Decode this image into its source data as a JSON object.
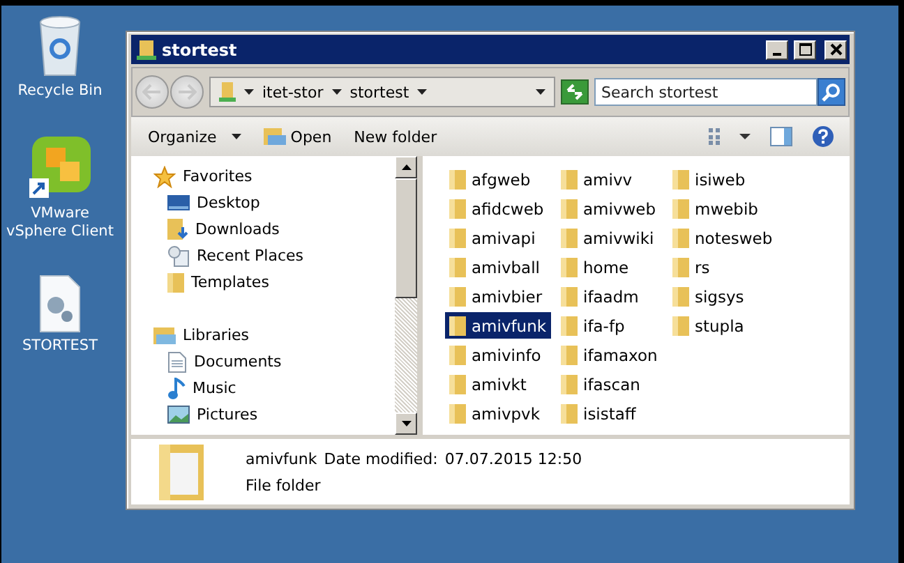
{
  "desktop_icons": [
    {
      "label": "Recycle Bin",
      "kind": "bin"
    },
    {
      "label": "VMware vSphere Client",
      "kind": "vmware"
    },
    {
      "label": "STORTEST",
      "kind": "config"
    }
  ],
  "window": {
    "title": "stortest"
  },
  "address_bar": {
    "breadcrumbs": [
      "itet-stor",
      "stortest"
    ]
  },
  "search": {
    "placeholder": "Search stortest"
  },
  "toolbar": {
    "organize": "Organize",
    "open": "Open",
    "new_folder": "New folder"
  },
  "navigation": [
    {
      "label": "Favorites",
      "kind": "star",
      "children": [
        {
          "label": "Desktop",
          "kind": "desktop"
        },
        {
          "label": "Downloads",
          "kind": "downloads"
        },
        {
          "label": "Recent Places",
          "kind": "recent"
        },
        {
          "label": "Templates",
          "kind": "folder"
        }
      ]
    },
    {
      "label": "Libraries",
      "kind": "library",
      "children": [
        {
          "label": "Documents",
          "kind": "document"
        },
        {
          "label": "Music",
          "kind": "music"
        },
        {
          "label": "Pictures",
          "kind": "pictures"
        }
      ]
    }
  ],
  "files": [
    {
      "name": "afgweb",
      "selected": false
    },
    {
      "name": "afidcweb",
      "selected": false
    },
    {
      "name": "amivapi",
      "selected": false
    },
    {
      "name": "amivball",
      "selected": false
    },
    {
      "name": "amivbier",
      "selected": false
    },
    {
      "name": "amivfunk",
      "selected": true
    },
    {
      "name": "amivinfo",
      "selected": false
    },
    {
      "name": "amivkt",
      "selected": false
    },
    {
      "name": "amivpvk",
      "selected": false
    },
    {
      "name": "amivv",
      "selected": false
    },
    {
      "name": "amivweb",
      "selected": false
    },
    {
      "name": "amivwiki",
      "selected": false
    },
    {
      "name": "home",
      "selected": false
    },
    {
      "name": "ifaadm",
      "selected": false
    },
    {
      "name": "ifa-fp",
      "selected": false
    },
    {
      "name": "ifamaxon",
      "selected": false
    },
    {
      "name": "ifascan",
      "selected": false
    },
    {
      "name": "isistaff",
      "selected": false
    },
    {
      "name": "isiweb",
      "selected": false
    },
    {
      "name": "mwebib",
      "selected": false
    },
    {
      "name": "notesweb",
      "selected": false
    },
    {
      "name": "rs",
      "selected": false
    },
    {
      "name": "sigsys",
      "selected": false
    },
    {
      "name": "stupla",
      "selected": false
    }
  ],
  "details": {
    "name": "amivfunk",
    "modified_label": "Date modified:",
    "modified": "07.07.2015 12:50",
    "type": "File folder"
  }
}
